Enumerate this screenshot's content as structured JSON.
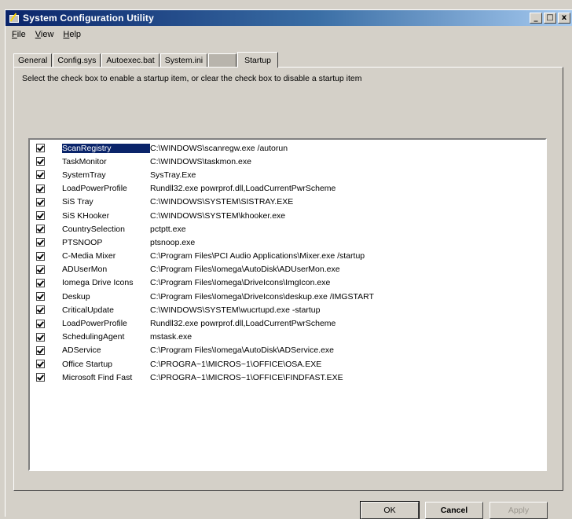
{
  "window": {
    "title": "System Configuration Utility"
  },
  "titlebar_buttons": [
    "_",
    "□",
    "x"
  ],
  "menu": [
    {
      "label": "File",
      "underline": "F",
      "rest": "ile"
    },
    {
      "label": "View",
      "underline": "V",
      "rest": "iew"
    },
    {
      "label": "Help",
      "underline": "H",
      "rest": "elp"
    }
  ],
  "tabs": [
    {
      "label": "General"
    },
    {
      "label": "Config.sys"
    },
    {
      "label": "Autoexec.bat"
    },
    {
      "label": "System.ini"
    },
    {
      "label": ""
    },
    {
      "label": "Startup"
    }
  ],
  "instruction": "Select the check box to enable a startup item, or clear the check box to disable a startup item",
  "startup_items": [
    {
      "name": "ScanRegistry",
      "command": "C:\\WINDOWS\\scanregw.exe /autorun",
      "checked": true,
      "selected": true
    },
    {
      "name": "TaskMonitor",
      "command": "C:\\WINDOWS\\taskmon.exe",
      "checked": true
    },
    {
      "name": "SystemTray",
      "command": "SysTray.Exe",
      "checked": true
    },
    {
      "name": "LoadPowerProfile",
      "command": "Rundll32.exe powrprof.dll,LoadCurrentPwrScheme",
      "checked": true
    },
    {
      "name": "SiS Tray",
      "command": "C:\\WINDOWS\\SYSTEM\\SISTRAY.EXE",
      "checked": true
    },
    {
      "name": "SiS KHooker",
      "command": "C:\\WINDOWS\\SYSTEM\\khooker.exe",
      "checked": true
    },
    {
      "name": "CountrySelection",
      "command": "pctptt.exe",
      "checked": true
    },
    {
      "name": "PTSNOOP",
      "command": "ptsnoop.exe",
      "checked": true
    },
    {
      "name": "C-Media Mixer",
      "command": "C:\\Program Files\\PCI Audio Applications\\Mixer.exe /startup",
      "checked": true
    },
    {
      "name": "ADUserMon",
      "command": "C:\\Program Files\\Iomega\\AutoDisk\\ADUserMon.exe",
      "checked": true
    },
    {
      "name": "Iomega Drive Icons",
      "command": "C:\\Program Files\\Iomega\\DriveIcons\\ImgIcon.exe",
      "checked": true
    },
    {
      "name": "Deskup",
      "command": "C:\\Program Files\\Iomega\\DriveIcons\\deskup.exe /IMGSTART",
      "checked": true
    },
    {
      "name": "CriticalUpdate",
      "command": "C:\\WINDOWS\\SYSTEM\\wucrtupd.exe -startup",
      "checked": true
    },
    {
      "name": "LoadPowerProfile",
      "command": "Rundll32.exe powrprof.dll,LoadCurrentPwrScheme",
      "checked": true
    },
    {
      "name": "SchedulingAgent",
      "command": "mstask.exe",
      "checked": true
    },
    {
      "name": "ADService",
      "command": "C:\\Program Files\\Iomega\\AutoDisk\\ADService.exe",
      "checked": true
    },
    {
      "name": "Office Startup",
      "command": "C:\\PROGRA~1\\MICROS~1\\OFFICE\\OSA.EXE",
      "checked": true
    },
    {
      "name": "Microsoft Find Fast",
      "command": "C:\\PROGRA~1\\MICROS~1\\OFFICE\\FINDFAST.EXE",
      "checked": true
    }
  ],
  "buttons": {
    "ok": "OK",
    "cancel": "Cancel",
    "apply": "Apply"
  },
  "colors": {
    "selection": "#0a246a",
    "face": "#d4d0c8"
  }
}
